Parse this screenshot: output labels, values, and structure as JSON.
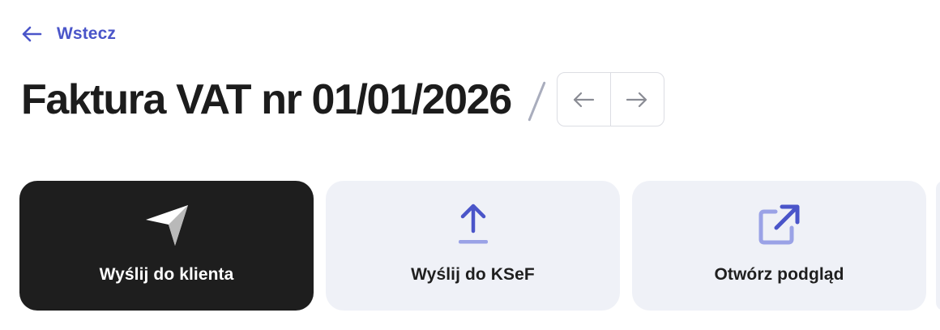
{
  "nav": {
    "back_label": "Wstecz",
    "back_icon": "arrow-left-icon"
  },
  "header": {
    "title": "Faktura VAT nr 01/01/2026",
    "pager": {
      "prev_icon": "arrow-left-icon",
      "next_icon": "arrow-right-icon"
    }
  },
  "actions": [
    {
      "label": "Wyślij do klienta",
      "icon": "send-icon",
      "variant": "primary"
    },
    {
      "label": "Wyślij do KSeF",
      "icon": "upload-icon",
      "variant": "secondary"
    },
    {
      "label": "Otwórz podgląd",
      "icon": "open-external-icon",
      "variant": "secondary"
    }
  ],
  "colors": {
    "accent": "#4a55c9",
    "primary_card": "#1e1e1e",
    "secondary_card": "#eff1f7",
    "title_text": "#1c1c1c",
    "icon_light": "#9aa2e6"
  }
}
